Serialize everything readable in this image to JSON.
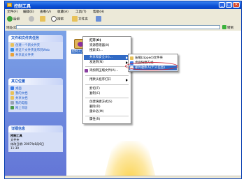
{
  "window": {
    "title": "控制工具",
    "controls": {
      "minimize": "_",
      "maximize": "□",
      "close": "×"
    }
  },
  "menubar": [
    "文件(F)",
    "编辑(E)",
    "查看(V)",
    "收藏(A)",
    "工具(T)",
    "帮助(H)"
  ],
  "toolbar": {
    "back": "后退",
    "search": "搜索",
    "folders": "文件夹"
  },
  "address": {
    "label": "地址(D)",
    "value": "",
    "go": "转到"
  },
  "sidebar": {
    "tasks_header": "文件和文件夹任务",
    "tasks": [
      "创建一个新文件夹",
      "将这个文件夹发布到Web",
      "共享此文件夹"
    ],
    "places_header": "其它位置",
    "places": [
      "桌面",
      "我的文档",
      "共享文档",
      "我的电脑",
      "网上邻居"
    ],
    "details_header": "详细信息",
    "details_name": "控制工具",
    "details_type": "文件夹",
    "details_modified": "修改日期: 2007年8月6日",
    "details_time": "11:30"
  },
  "folder_icon_label": "控制工具",
  "context_menu": {
    "items": [
      {
        "label": "打开(O)",
        "bold": true
      },
      {
        "label": "资源管理器(X)"
      },
      {
        "label": "搜索(E)..."
      },
      {
        "label": "共享和安全(H)...",
        "highlight": true,
        "submenu": true
      },
      {
        "label": "发送到(N)",
        "submenu": true
      },
      {
        "label": "添加到压缩文件(A)..."
      },
      {
        "label": "用默认程序打开"
      },
      {
        "label": "剪切(T)"
      },
      {
        "label": "复制(C)"
      },
      {
        "label": "创建快捷方式(S)"
      },
      {
        "label": "删除(D)"
      },
      {
        "label": "重命名(M)"
      },
      {
        "label": "属性(R)"
      }
    ]
  },
  "submenu": {
    "items": [
      {
        "label": "压缩(zipped)文件夹"
      },
      {
        "label": "桌面快捷方式"
      },
      {
        "label": "邮件收件人(个人信息)",
        "highlight": true
      }
    ]
  }
}
